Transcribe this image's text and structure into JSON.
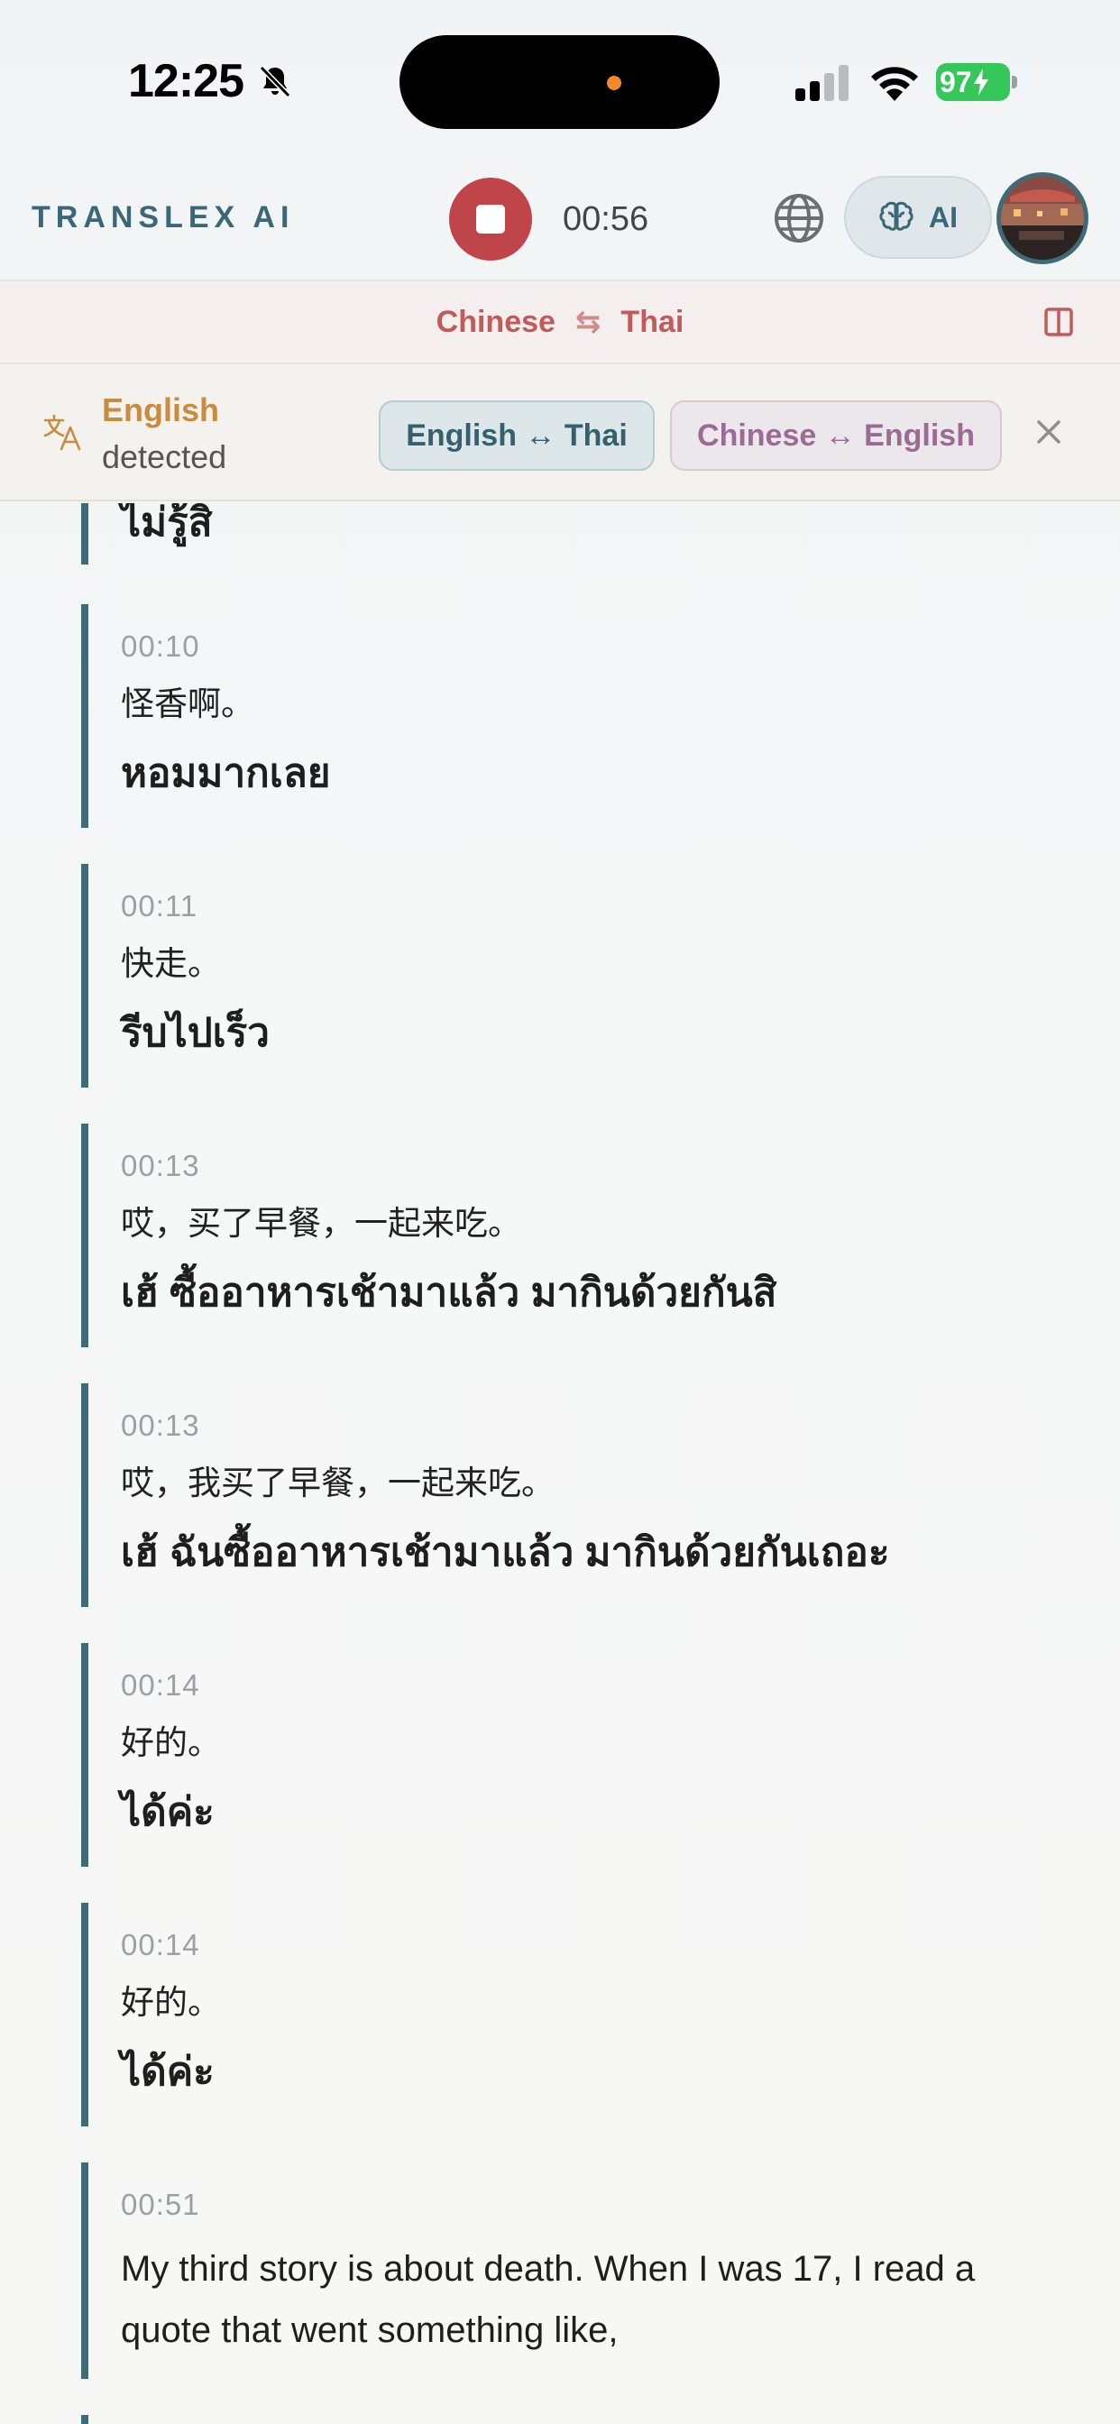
{
  "status_bar": {
    "time": "12:25",
    "battery": "97"
  },
  "header": {
    "brand": "TRANSLEX AI",
    "timer": "00:56",
    "ai_label": "AI"
  },
  "language_bar": {
    "source": "Chinese",
    "target": "Thai"
  },
  "detection": {
    "language": "English",
    "label": "detected",
    "options": [
      "English ↔ Thai",
      "Chinese ↔ English"
    ]
  },
  "transcript": [
    {
      "time": "",
      "source": "",
      "target": "ไม่รู้สิ"
    },
    {
      "time": "00:10",
      "source": "怪香啊。",
      "target": "หอมมากเลย"
    },
    {
      "time": "00:11",
      "source": "快走。",
      "target": "รีบไปเร็ว"
    },
    {
      "time": "00:13",
      "source": "哎，买了早餐，一起来吃。",
      "target": "เฮ้ ซื้ออาหารเช้ามาแล้ว มากินด้วยกันสิ"
    },
    {
      "time": "00:13",
      "source": "哎，我买了早餐，一起来吃。",
      "target": "เฮ้ ฉันซื้ออาหารเช้ามาแล้ว มากินด้วยกันเถอะ"
    },
    {
      "time": "00:14",
      "source": "好的。",
      "target": "ได้ค่ะ"
    },
    {
      "time": "00:14",
      "source": "好的。",
      "target": "ได้ค่ะ"
    },
    {
      "time": "00:51",
      "source": "My third story is about death. When I was 17, I read a quote that went something like,",
      "target": ""
    }
  ],
  "colors": {
    "accent": "#3d6b7b",
    "record": "#c0454a",
    "detected": "#c98c3c",
    "lang_pair": "#c25a5a"
  }
}
